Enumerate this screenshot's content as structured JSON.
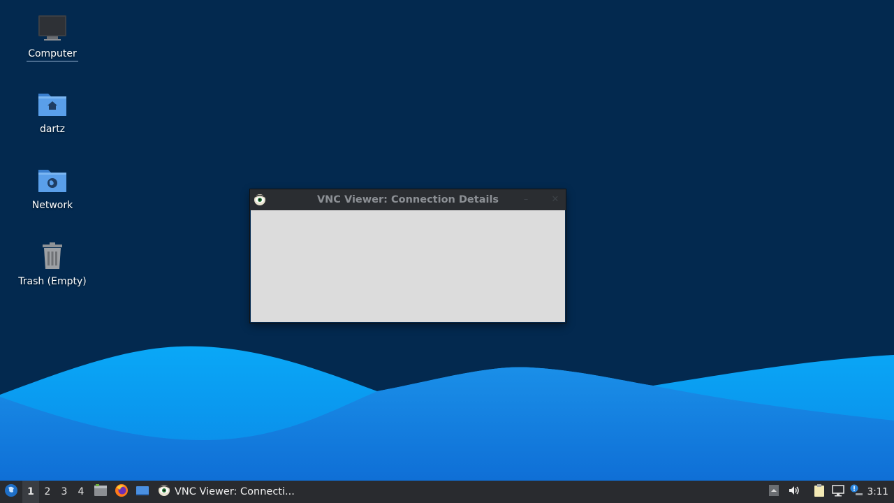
{
  "desktop": {
    "icons": [
      {
        "label": "Computer",
        "icon": "computer-icon",
        "selected": true
      },
      {
        "label": "dartz",
        "icon": "home-folder-icon"
      },
      {
        "label": "Network",
        "icon": "network-folder-icon"
      },
      {
        "label": "Trash (Empty)",
        "icon": "trash-icon"
      }
    ]
  },
  "window": {
    "title": "VNC Viewer: Connection Details",
    "icon": "vnc-viewer-icon",
    "minimize_glyph": "–",
    "close_glyph": "✕"
  },
  "taskbar": {
    "workspaces": [
      "1",
      "2",
      "3",
      "4"
    ],
    "active_workspace": "1",
    "launchers": [
      "file-manager-icon",
      "firefox-icon",
      "desktop-icon"
    ],
    "task_label": "VNC Viewer: Connecti...",
    "tray": [
      "tray-expand-icon",
      "volume-icon",
      "clipboard-icon",
      "network-icon",
      "update-notifier-icon"
    ],
    "clock": "3:11"
  },
  "colors": {
    "desktop_bg": "#03294f",
    "wave_light": "#1596ea",
    "wave_bright": "#0ea3f5",
    "taskbar_bg": "#292b2f",
    "titlebar_bg": "#2a2d31",
    "window_body": "#dcdcdc"
  }
}
